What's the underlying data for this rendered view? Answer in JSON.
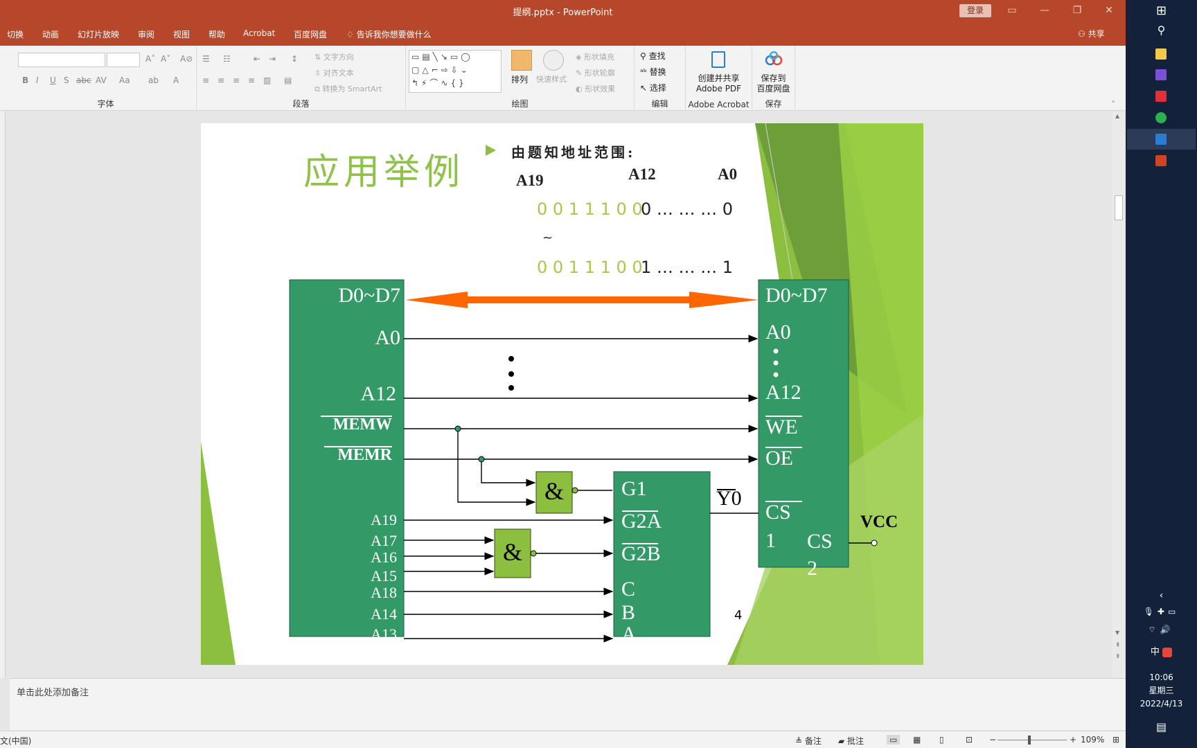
{
  "window": {
    "title": "提纲.pptx  -  PowerPoint",
    "login": "登录"
  },
  "tabs": [
    "切换",
    "动画",
    "幻灯片放映",
    "审阅",
    "视图",
    "帮助",
    "Acrobat",
    "百度网盘"
  ],
  "tellme": "告诉我你想要做什么",
  "share": "共享",
  "ribbon": {
    "font_group": "字体",
    "paragraph_group": "段落",
    "drawing_group": "绘图",
    "editing_group": "编辑",
    "acrobat_group": "Adobe Acrobat",
    "save_group": "保存",
    "text_direction": "文字方向",
    "align_text": "对齐文本",
    "smartart": "转换为 SmartArt",
    "arrange": "排列",
    "quick_styles": "快速样式",
    "shape_fill": "形状填充",
    "shape_outline": "形状轮廓",
    "shape_effects": "形状效果",
    "find": "查找",
    "replace": "替换",
    "select": "选择",
    "create_pdf_line1": "创建并共享",
    "create_pdf_line2": "Adobe PDF",
    "save_baidu_line1": "保存到",
    "save_baidu_line2": "百度网盘"
  },
  "slide": {
    "title": "应用举例",
    "bullet": "由题知地址范围:",
    "hdr_a19": "A19",
    "hdr_a12": "A12",
    "hdr_a0": "A0",
    "row1_green": "0 0 1 1 1 0 0",
    "row1_black": "0 … … … 0",
    "tilde": "~",
    "row2_green": "0 0 1 1 1 0 0",
    "row2_black": "1 … … … 1",
    "cpu_d": "D0~D7",
    "cpu_a0": "A0",
    "cpu_a12": "A12",
    "cpu_memw": "MEMW",
    "cpu_memr": "MEMR",
    "cpu_a19": "A19",
    "cpu_a17": "A17",
    "cpu_a16": "A16",
    "cpu_a15": "A15",
    "cpu_a18": "A18",
    "cpu_a14": "A14",
    "cpu_a13": "A13",
    "and_symbol": "&",
    "dec_g1": "G1",
    "dec_g2a": "G2A",
    "dec_g2b": "G2B",
    "dec_c": "C",
    "dec_b": "B",
    "dec_a": "A",
    "y0": "Y0",
    "mem_d": "D0~D7",
    "mem_a0": "A0",
    "mem_a12": "A12",
    "mem_we": "WE",
    "mem_oe": "OE",
    "mem_cs1a": "CS",
    "mem_cs1b": "1",
    "mem_cs2a": "CS",
    "mem_cs2b": "2",
    "vcc": "VCC",
    "page_number": "4"
  },
  "notes_placeholder": "单击此处添加备注",
  "status": {
    "lang": "文(中国)",
    "notes_btn": "备注",
    "comments_btn": "批注",
    "zoom": "109%"
  },
  "taskbar": {
    "time": "10:06",
    "weekday": "星期三",
    "date": "2022/4/13",
    "ime": "中"
  },
  "colors": {
    "ribbon_red": "#b7472a",
    "slide_green": "#339966",
    "gate_green": "#8cbf3f",
    "arrow_orange": "#ff6600",
    "title_green": "#8fc24a",
    "taskbar": "#14213a"
  }
}
